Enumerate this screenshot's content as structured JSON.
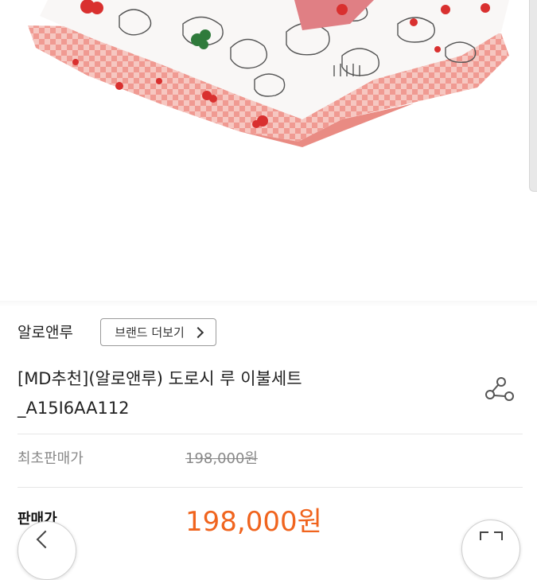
{
  "product": {
    "brand": "알로앤루",
    "brand_button": "브랜드 더보기",
    "title_line1": "[MD추천](알로앤루) 도로시 루 이불세트",
    "title_line2": "_A15I6AA112"
  },
  "price": {
    "original_label": "최초판매가",
    "original_value": "198,000원",
    "sale_label": "판매가",
    "sale_value": "198,000원"
  },
  "colors": {
    "sale_price": "#f0641e",
    "quilt_pink": "#f2b3ad",
    "quilt_red": "#d9302f",
    "quilt_green": "#2f7a3b"
  },
  "icons": {
    "share": "share-icon",
    "back": "chevron-left-icon",
    "brand_more": "chevron-right-icon"
  }
}
